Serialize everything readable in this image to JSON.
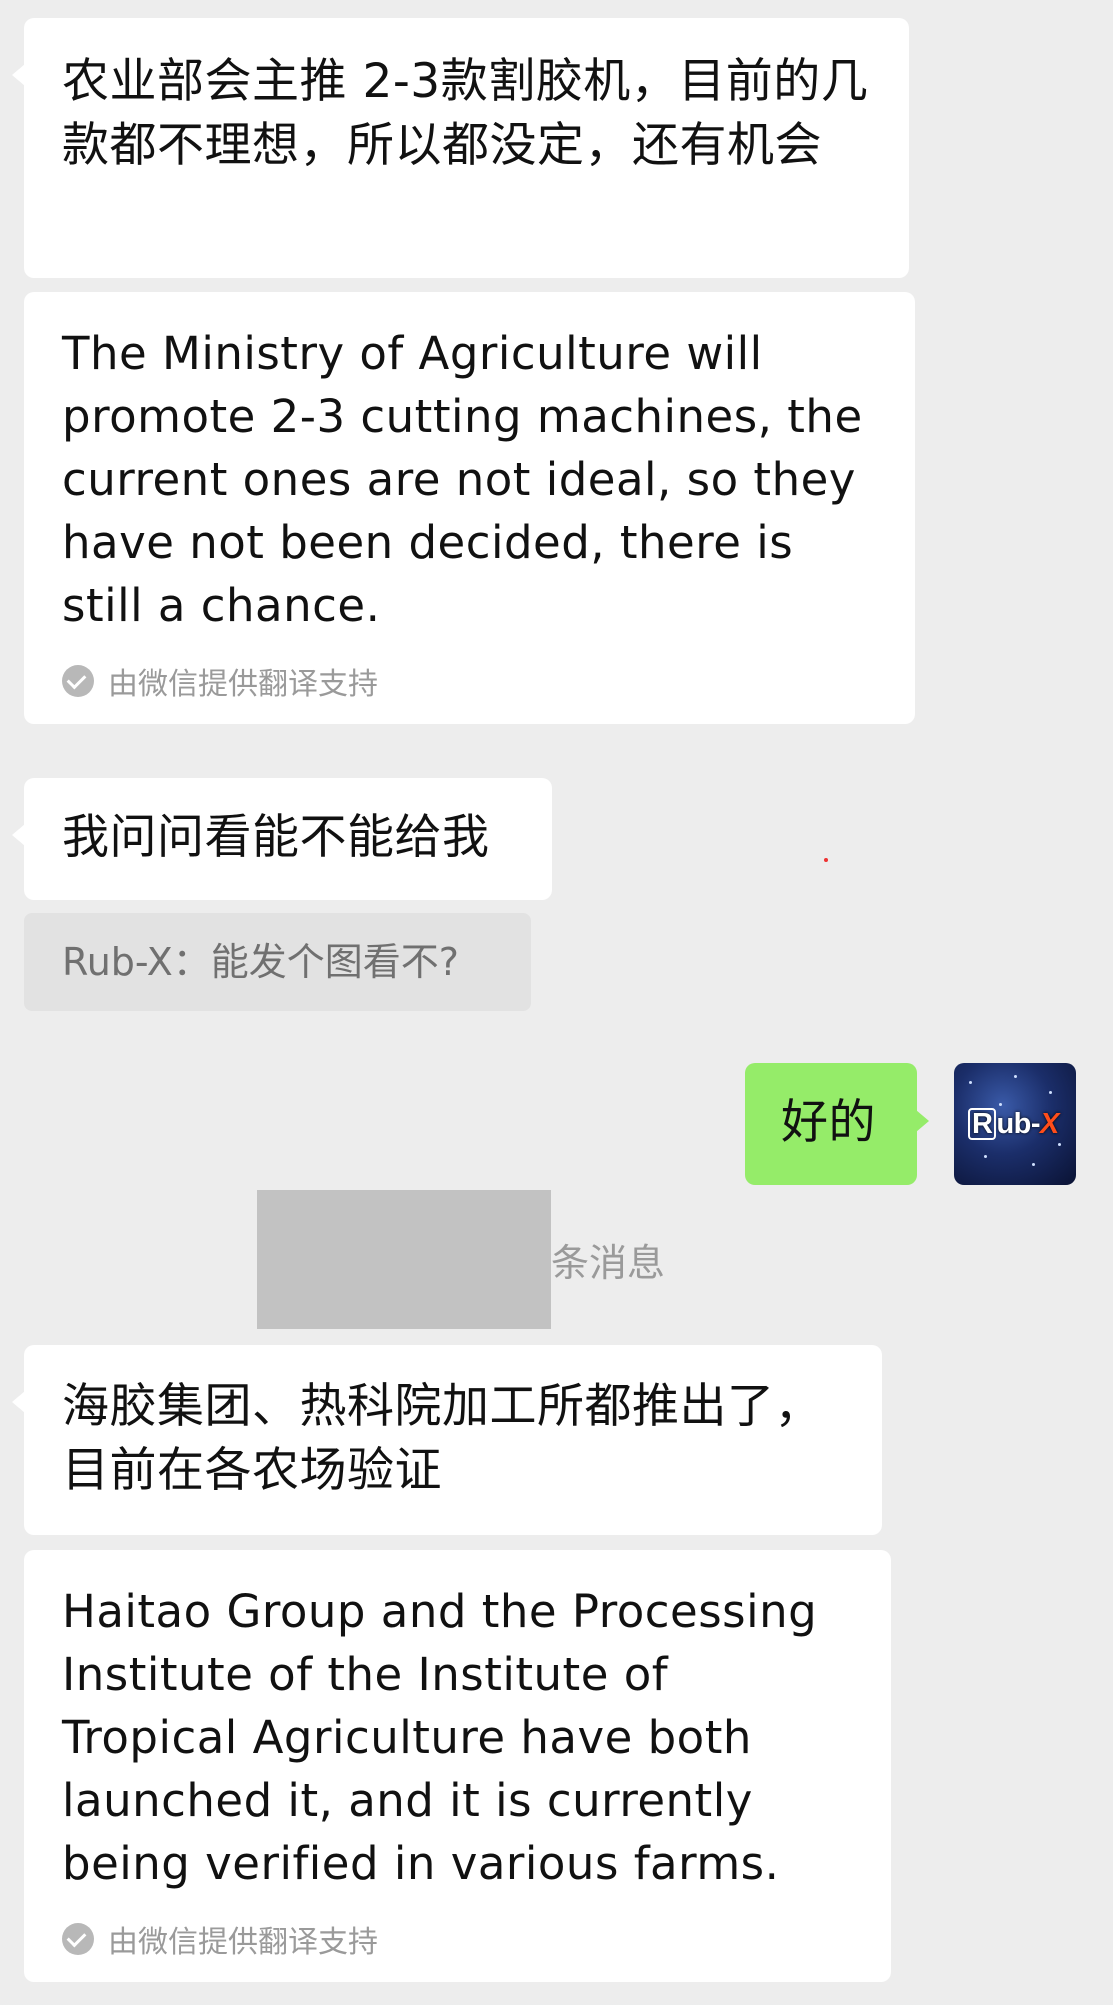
{
  "messages": [
    {
      "text": "农业部会主推 2-3款割胶机，目前的几款都不理想，所以都没定，还有机会"
    },
    {
      "translation": "The Ministry of Agriculture will promote 2-3 cutting machines, the current ones are not ideal, so they have not been decided, there is still a chance.",
      "note": "由微信提供翻译支持"
    },
    {
      "text": "我问问看能不能给我"
    },
    {
      "quote": "Rub-X：能发个图看不?"
    },
    {
      "text": "好的",
      "avatar_label": "Rub-X"
    },
    {
      "system_notice": "条消息"
    },
    {
      "text": "海胶集团、热科院加工所都推出了，目前在各农场验证"
    },
    {
      "translation": "Haitao Group and the Processing Institute of the Institute of Tropical Agriculture have both launched it, and it is currently being verified in various farms.",
      "note": "由微信提供翻译支持"
    }
  ],
  "icons": {
    "translation_check": "check-circle-icon"
  },
  "colors": {
    "background": "#ededed",
    "incoming_bubble": "#ffffff",
    "outgoing_bubble": "#95ec69",
    "quote_bg": "#e2e2e2",
    "muted_text": "#9a9a9a"
  }
}
